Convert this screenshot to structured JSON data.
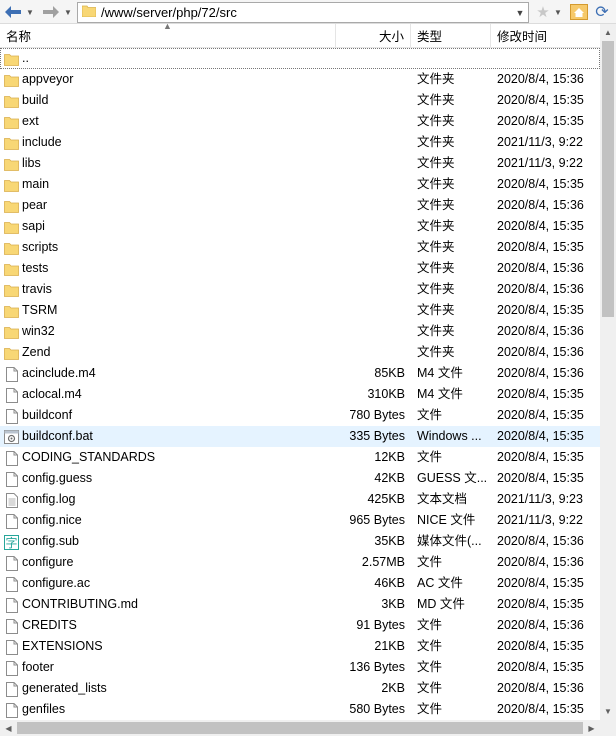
{
  "toolbar": {
    "address": "/www/server/php/72/src"
  },
  "header": {
    "name": "名称",
    "size": "大小",
    "type": "类型",
    "date": "修改时间"
  },
  "colors": {
    "folder": "#f8d775",
    "selected_row": "#e5f3ff",
    "nav_arrow": "#3d6fb4"
  },
  "rows": [
    {
      "name": "..",
      "size": "",
      "type": "",
      "date": "",
      "icon": "folder-icon",
      "focused": true
    },
    {
      "name": "appveyor",
      "size": "",
      "type": "文件夹",
      "date": "2020/8/4, 15:36",
      "icon": "folder-icon"
    },
    {
      "name": "build",
      "size": "",
      "type": "文件夹",
      "date": "2020/8/4, 15:35",
      "icon": "folder-icon"
    },
    {
      "name": "ext",
      "size": "",
      "type": "文件夹",
      "date": "2020/8/4, 15:35",
      "icon": "folder-icon"
    },
    {
      "name": "include",
      "size": "",
      "type": "文件夹",
      "date": "2021/11/3, 9:22",
      "icon": "folder-icon"
    },
    {
      "name": "libs",
      "size": "",
      "type": "文件夹",
      "date": "2021/11/3, 9:22",
      "icon": "folder-icon"
    },
    {
      "name": "main",
      "size": "",
      "type": "文件夹",
      "date": "2020/8/4, 15:35",
      "icon": "folder-icon"
    },
    {
      "name": "pear",
      "size": "",
      "type": "文件夹",
      "date": "2020/8/4, 15:36",
      "icon": "folder-icon"
    },
    {
      "name": "sapi",
      "size": "",
      "type": "文件夹",
      "date": "2020/8/4, 15:35",
      "icon": "folder-icon"
    },
    {
      "name": "scripts",
      "size": "",
      "type": "文件夹",
      "date": "2020/8/4, 15:35",
      "icon": "folder-icon"
    },
    {
      "name": "tests",
      "size": "",
      "type": "文件夹",
      "date": "2020/8/4, 15:36",
      "icon": "folder-icon"
    },
    {
      "name": "travis",
      "size": "",
      "type": "文件夹",
      "date": "2020/8/4, 15:36",
      "icon": "folder-icon"
    },
    {
      "name": "TSRM",
      "size": "",
      "type": "文件夹",
      "date": "2020/8/4, 15:35",
      "icon": "folder-icon"
    },
    {
      "name": "win32",
      "size": "",
      "type": "文件夹",
      "date": "2020/8/4, 15:36",
      "icon": "folder-icon"
    },
    {
      "name": "Zend",
      "size": "",
      "type": "文件夹",
      "date": "2020/8/4, 15:36",
      "icon": "folder-icon"
    },
    {
      "name": "acinclude.m4",
      "size": "85KB",
      "type": "M4 文件",
      "date": "2020/8/4, 15:36",
      "icon": "file-icon"
    },
    {
      "name": "aclocal.m4",
      "size": "310KB",
      "type": "M4 文件",
      "date": "2020/8/4, 15:35",
      "icon": "file-icon"
    },
    {
      "name": "buildconf",
      "size": "780 Bytes",
      "type": "文件",
      "date": "2020/8/4, 15:35",
      "icon": "file-icon"
    },
    {
      "name": "buildconf.bat",
      "size": "335 Bytes",
      "type": "Windows ...",
      "date": "2020/8/4, 15:35",
      "icon": "batch-file-icon",
      "selected": true
    },
    {
      "name": "CODING_STANDARDS",
      "size": "12KB",
      "type": "文件",
      "date": "2020/8/4, 15:35",
      "icon": "file-icon"
    },
    {
      "name": "config.guess",
      "size": "42KB",
      "type": "GUESS 文...",
      "date": "2020/8/4, 15:35",
      "icon": "file-icon"
    },
    {
      "name": "config.log",
      "size": "425KB",
      "type": "文本文档",
      "date": "2021/11/3, 9:23",
      "icon": "text-file-icon"
    },
    {
      "name": "config.nice",
      "size": "965 Bytes",
      "type": "NICE 文件",
      "date": "2021/11/3, 9:22",
      "icon": "file-icon"
    },
    {
      "name": "config.sub",
      "size": "35KB",
      "type": "媒体文件(...",
      "date": "2020/8/4, 15:36",
      "icon": "subtitle-file-icon"
    },
    {
      "name": "configure",
      "size": "2.57MB",
      "type": "文件",
      "date": "2020/8/4, 15:36",
      "icon": "file-icon"
    },
    {
      "name": "configure.ac",
      "size": "46KB",
      "type": "AC 文件",
      "date": "2020/8/4, 15:35",
      "icon": "file-icon"
    },
    {
      "name": "CONTRIBUTING.md",
      "size": "3KB",
      "type": "MD 文件",
      "date": "2020/8/4, 15:35",
      "icon": "file-icon"
    },
    {
      "name": "CREDITS",
      "size": "91 Bytes",
      "type": "文件",
      "date": "2020/8/4, 15:36",
      "icon": "file-icon"
    },
    {
      "name": "EXTENSIONS",
      "size": "21KB",
      "type": "文件",
      "date": "2020/8/4, 15:35",
      "icon": "file-icon"
    },
    {
      "name": "footer",
      "size": "136 Bytes",
      "type": "文件",
      "date": "2020/8/4, 15:35",
      "icon": "file-icon"
    },
    {
      "name": "generated_lists",
      "size": "2KB",
      "type": "文件",
      "date": "2020/8/4, 15:36",
      "icon": "file-icon"
    },
    {
      "name": "genfiles",
      "size": "580 Bytes",
      "type": "文件",
      "date": "2020/8/4, 15:35",
      "icon": "file-icon"
    }
  ]
}
